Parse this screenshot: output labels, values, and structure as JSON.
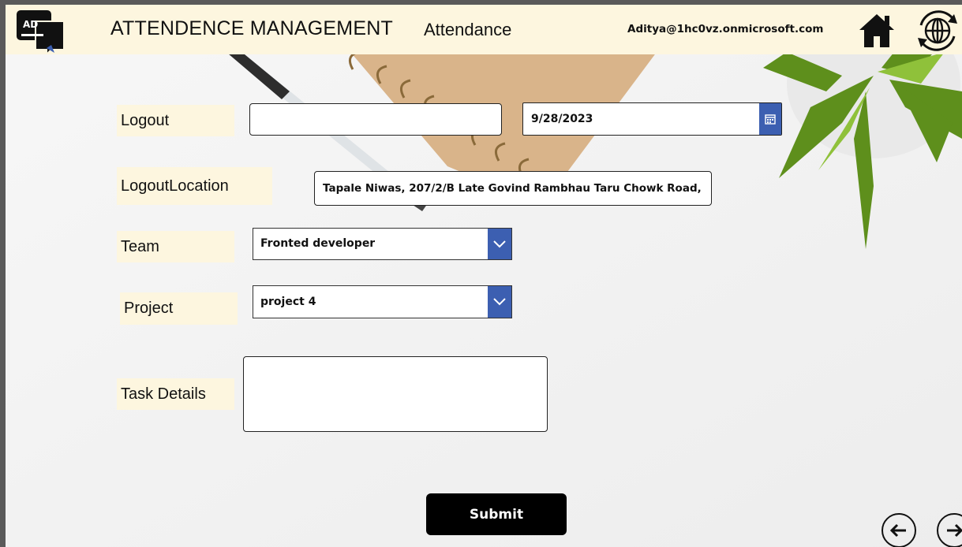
{
  "header": {
    "logo_text": "AD",
    "app_title": "ATTENDENCE MANAGEMENT",
    "screen_title": "Attendance",
    "user_email": "Aditya@1hc0vz.onmicrosoft.com",
    "home_icon": "home-icon",
    "sync_icon": "globe-sync-icon"
  },
  "form": {
    "logout": {
      "label": "Logout",
      "time_value": "",
      "date_value": "9/28/2023",
      "calendar_icon": "calendar-icon"
    },
    "logout_location": {
      "label": "LogoutLocation",
      "value": "Tapale Niwas, 207/2/B Late Govind Rambhau Taru Chowk Road,"
    },
    "team": {
      "label": "Team",
      "selected": "Fronted developer",
      "dropdown_icon": "chevron-down-icon"
    },
    "project": {
      "label": "Project",
      "selected": "project 4",
      "dropdown_icon": "chevron-down-icon"
    },
    "task_details": {
      "label": "Task Details",
      "value": ""
    },
    "submit_label": "Submit"
  },
  "footer": {
    "back_icon": "arrow-left-icon",
    "forward_icon": "arrow-right-icon"
  },
  "colors": {
    "header_bg": "#fdf6df",
    "label_bg": "#fdf6df",
    "accent_blue": "#3c5fb1",
    "submit_bg": "#000000"
  }
}
